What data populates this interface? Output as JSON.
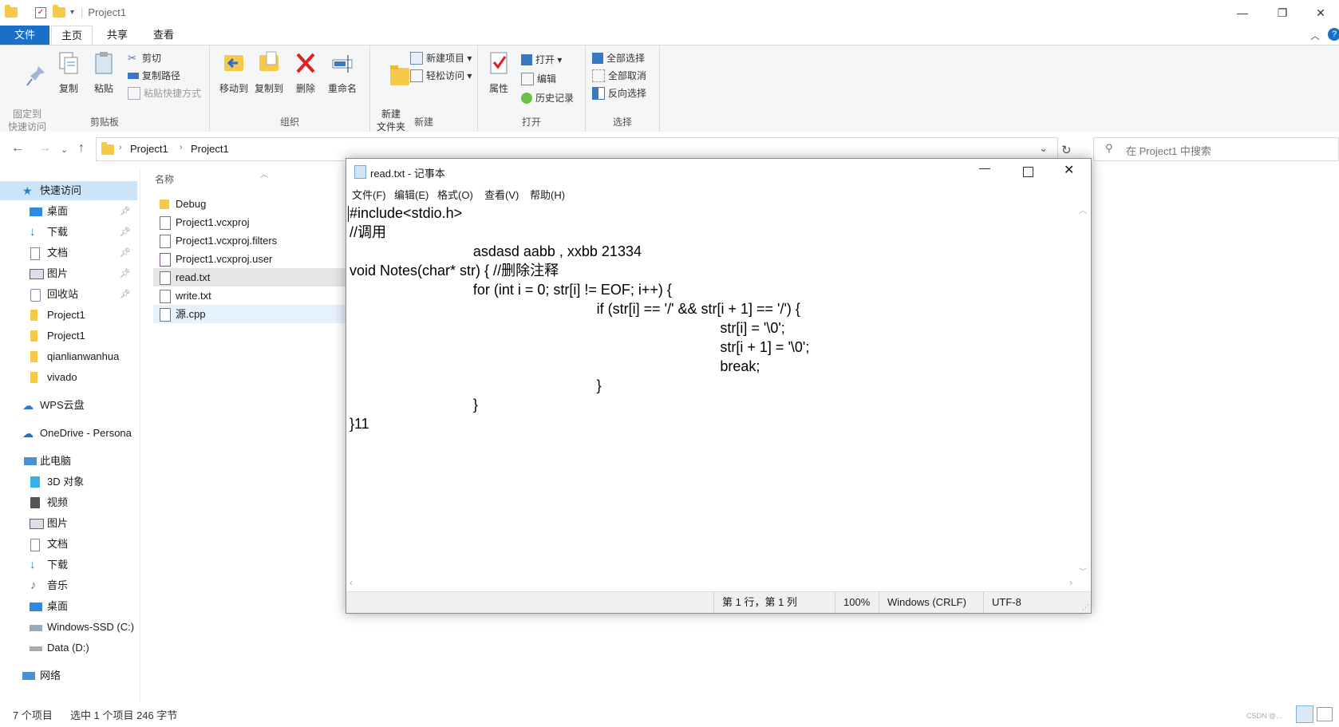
{
  "explorer": {
    "title": "Project1",
    "tabs": [
      "文件",
      "主页",
      "共享",
      "查看"
    ],
    "ribbon": {
      "clipboard": {
        "label": "剪贴板",
        "pin": "固定到\n快速访问",
        "copy": "复制",
        "paste": "粘贴",
        "cut": "剪切",
        "copy_path": "复制路径",
        "paste_shortcut": "粘贴快捷方式"
      },
      "organize": {
        "label": "组织",
        "move_to": "移动到",
        "copy_to": "复制到",
        "delete": "删除",
        "rename": "重命名"
      },
      "new": {
        "label": "新建",
        "new_folder": "新建\n文件夹",
        "new_item": "新建项目 ▾",
        "easy_access": "轻松访问 ▾"
      },
      "open": {
        "label": "打开",
        "properties": "属性",
        "open": "打开 ▾",
        "edit": "编辑",
        "history": "历史记录"
      },
      "select": {
        "label": "选择",
        "select_all": "全部选择",
        "select_none": "全部取消",
        "invert": "反向选择"
      }
    },
    "breadcrumb": [
      "Project1",
      "Project1"
    ],
    "search_placeholder": "在 Project1 中搜索",
    "nav": {
      "quick_access": "快速访问",
      "quick_items": [
        "桌面",
        "下载",
        "文档",
        "图片",
        "回收站",
        "Project1",
        "Project1",
        "qianlianwanhua",
        "vivado"
      ],
      "wps": "WPS云盘",
      "onedrive": "OneDrive - Persona",
      "this_pc": "此电脑",
      "pc_items": [
        "3D 对象",
        "视频",
        "图片",
        "文档",
        "下载",
        "音乐",
        "桌面",
        "Windows-SSD (C:)",
        "Data (D:)"
      ],
      "network": "网络"
    },
    "column_name": "名称",
    "files": [
      "Debug",
      "Project1.vcxproj",
      "Project1.vcxproj.filters",
      "Project1.vcxproj.user",
      "read.txt",
      "write.txt",
      "源.cpp"
    ],
    "status_count": "7 个项目",
    "status_selected": "选中 1 个项目  246 字节",
    "watermark": "CSDN @..."
  },
  "notepad": {
    "title": "read.txt - 记事本",
    "menu": [
      "文件(F)",
      "编辑(E)",
      "格式(O)",
      "查看(V)",
      "帮助(H)"
    ],
    "lines": [
      "#include<stdio.h>",
      "//调用",
      "\t\tasdasd aabb , xxbb 21334",
      "void Notes(char* str) { //删除注释",
      "\t\tfor (int i = 0; str[i] != EOF; i++) {",
      "\t\t\t\tif (str[i] == '/' && str[i + 1] == '/') {",
      "\t\t\t\t\t\tstr[i] = '\\0';",
      "\t\t\t\t\t\tstr[i + 1] = '\\0';",
      "\t\t\t\t\t\tbreak;",
      "\t\t\t\t}",
      "\t\t}",
      "}11"
    ],
    "status": {
      "pos": "第 1 行，第 1 列",
      "zoom": "100%",
      "eol": "Windows (CRLF)",
      "encoding": "UTF-8"
    }
  },
  "colors": {
    "accent": "#1a6fc9",
    "selected_row": "#e5e5e5",
    "hover_row": "#e5f1fb"
  }
}
